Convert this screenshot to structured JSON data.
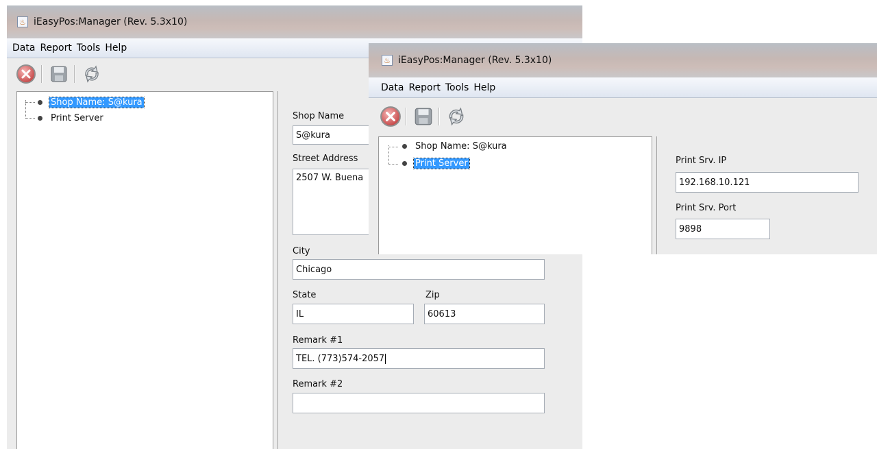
{
  "window_title": "iEasyPos:Manager (Rev. 5.3x10)",
  "menu": [
    "Data",
    "Report",
    "Tools",
    "Help"
  ],
  "toolbar": {
    "exit_icon": "cancel-icon",
    "save_icon": "floppy-disk-icon",
    "refresh_icon": "refresh-icon"
  },
  "tree": {
    "items": [
      "Shop Name: S@kura",
      "Print Server"
    ]
  },
  "shop_form": {
    "shop_name_label": "Shop Name",
    "shop_name_value": "S@kura",
    "street_label": "Street Address",
    "street_value": "2507 W. Buena",
    "city_label": "City",
    "city_value": "Chicago",
    "state_label": "State",
    "state_value": "IL",
    "zip_label": "Zip",
    "zip_value": "60613",
    "remark1_label": "Remark #1",
    "remark1_value": "TEL. (773)574-2057",
    "remark2_label": "Remark #2",
    "remark2_value": ""
  },
  "print_form": {
    "ip_label": "Print Srv. IP",
    "ip_value": "192.168.10.121",
    "port_label": "Print Srv. Port",
    "port_value": "9898"
  },
  "colors": {
    "selection": "#3399ff",
    "menubar": "#e4eaf3",
    "window_bg": "#ececec"
  }
}
